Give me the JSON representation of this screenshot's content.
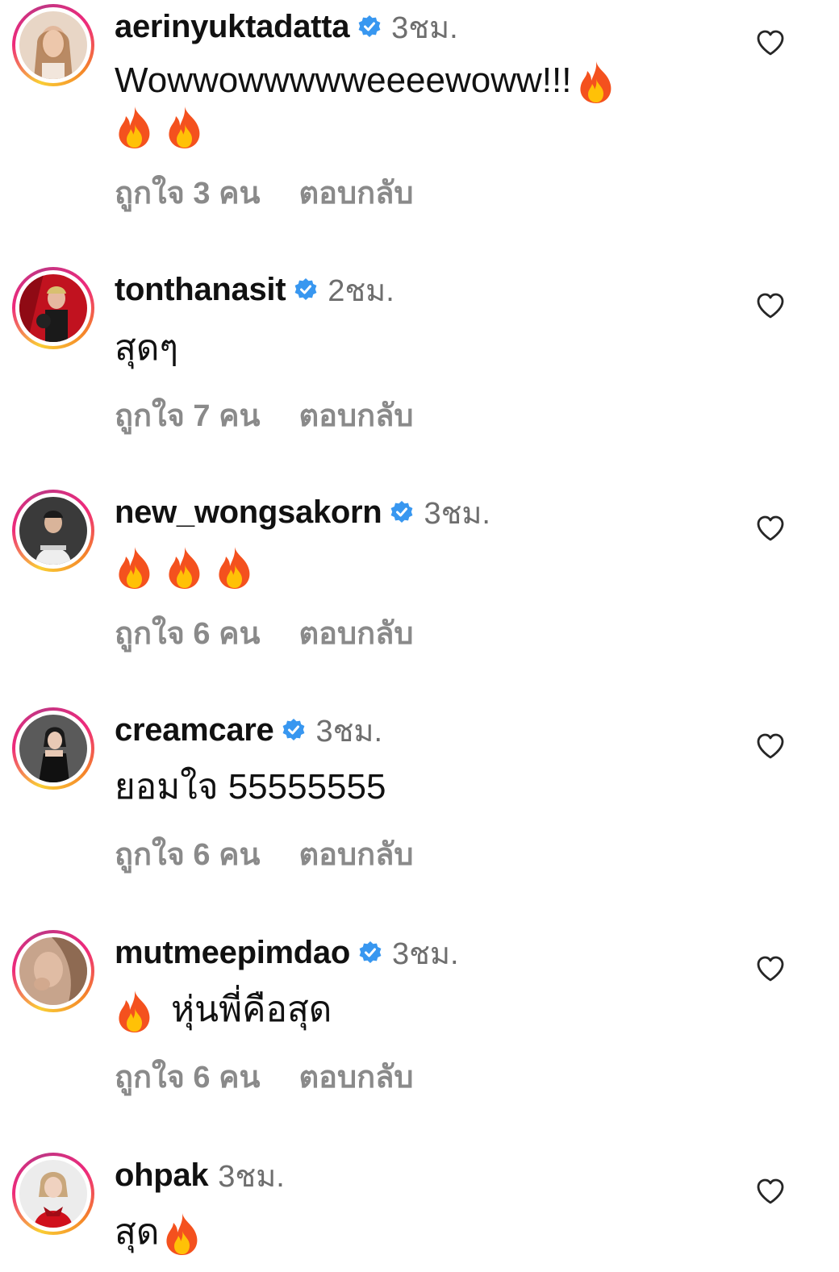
{
  "comments": [
    {
      "username": "aerinyuktadatta",
      "verified": true,
      "time": "3ชม.",
      "text_line1": "Wowwowwwwweeeewoww!!!",
      "likes": "ถูกใจ 3 คน",
      "reply": "ตอบกลับ",
      "avatar_color": "#d9c3b0"
    },
    {
      "username": "tonthanasit",
      "verified": true,
      "time": "2ชม.",
      "text": "สุดๆ",
      "likes": "ถูกใจ 7 คน",
      "reply": "ตอบกลับ",
      "avatar_color": "#c1121f"
    },
    {
      "username": "new_wongsakorn",
      "verified": true,
      "time": "3ชม.",
      "likes": "ถูกใจ 6 คน",
      "reply": "ตอบกลับ",
      "avatar_color": "#2b2b2b"
    },
    {
      "username": "creamcare",
      "verified": true,
      "time": "3ชม.",
      "text": "ยอมใจ 55555555",
      "likes": "ถูกใจ 6 คน",
      "reply": "ตอบกลับ",
      "avatar_color": "#4a4a4a"
    },
    {
      "username": "mutmeepimdao",
      "verified": true,
      "time": "3ชม.",
      "text": "หุ่นพี่คือสุด",
      "likes": "ถูกใจ 6 คน",
      "reply": "ตอบกลับ",
      "avatar_color": "#b89580"
    },
    {
      "username": "ohpak",
      "verified": false,
      "time": "3ชม.",
      "text": "สุด",
      "avatar_color": "#e8e0e0"
    }
  ],
  "icons": {
    "verified": "verified-badge-icon",
    "like": "heart-outline-icon",
    "emoji": "fire-emoji"
  },
  "colors": {
    "verified_blue": "#3897f0",
    "muted_text": "#8a8a8a",
    "fire_outer": "#f4511e",
    "fire_inner": "#ffc107"
  }
}
